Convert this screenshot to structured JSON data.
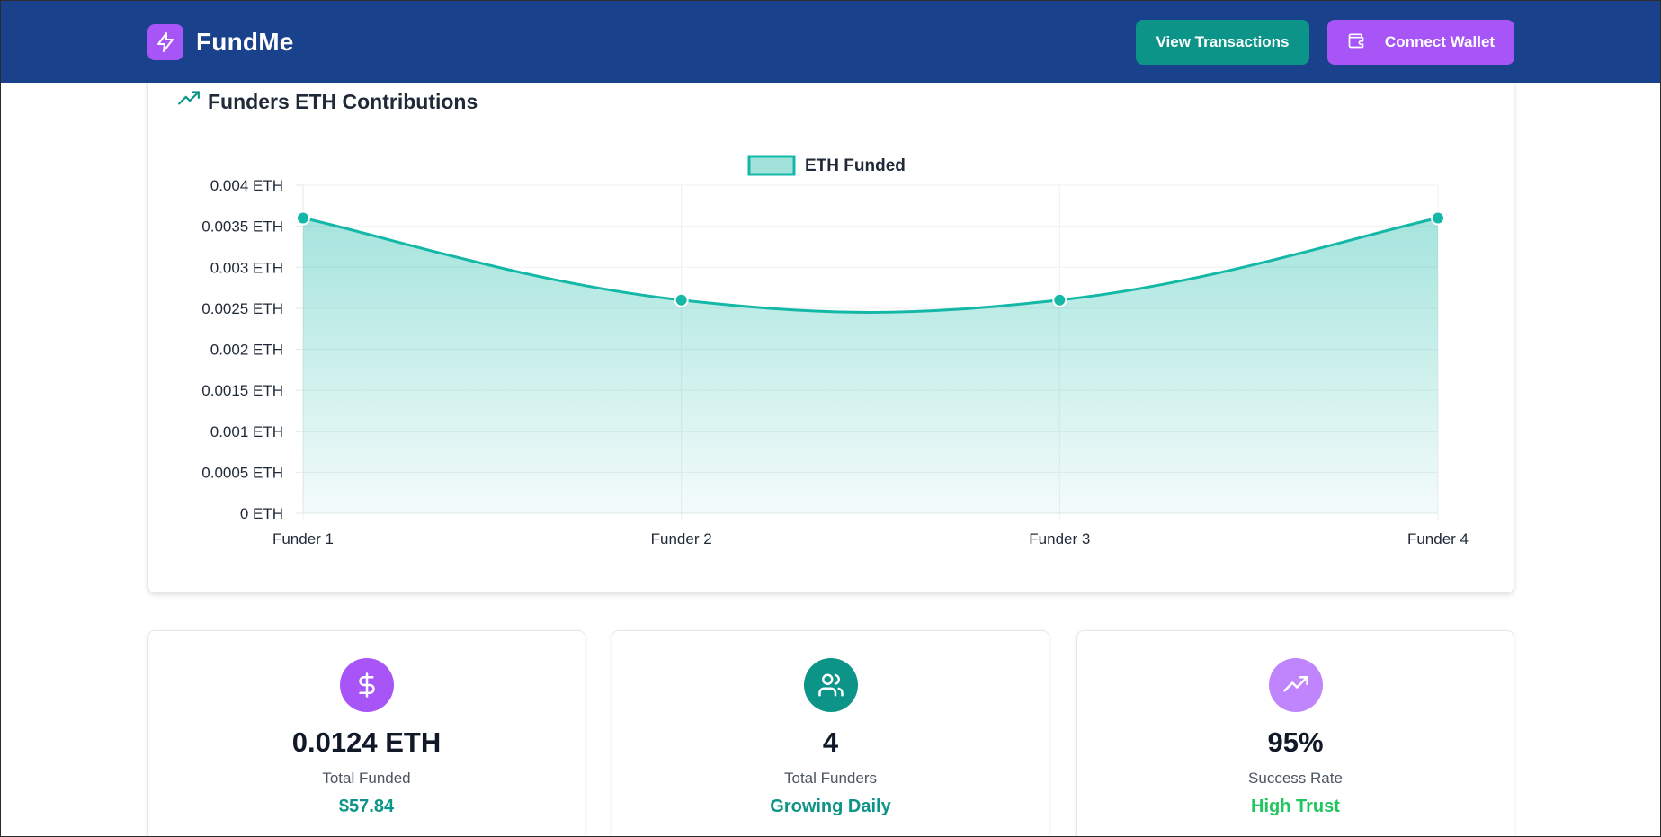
{
  "header": {
    "app_name": "FundMe",
    "logo_icon": "lightning-icon",
    "view_transactions_label": "View Transactions",
    "connect_wallet_label": "Connect Wallet",
    "wallet_icon": "wallet-icon",
    "colors": {
      "header_bg": "#1a418c",
      "brand": "#a855f7",
      "teal": "#0d9488"
    }
  },
  "chart_section": {
    "title": "Funders ETH Contributions",
    "title_icon": "trending-up-icon"
  },
  "chart_data": {
    "type": "area",
    "categories": [
      "Funder 1",
      "Funder 2",
      "Funder 3",
      "Funder 4"
    ],
    "series": [
      {
        "name": "ETH Funded",
        "values": [
          0.0036,
          0.0026,
          0.0026,
          0.0036
        ],
        "color": "#14b8a6"
      }
    ],
    "yticks": [
      "0 ETH",
      "0.0005 ETH",
      "0.001 ETH",
      "0.0015 ETH",
      "0.002 ETH",
      "0.0025 ETH",
      "0.003 ETH",
      "0.0035 ETH",
      "0.004 ETH"
    ],
    "ylim": [
      0,
      0.004
    ],
    "legend_position": "top-center",
    "grid": true,
    "smooth": true
  },
  "stats": [
    {
      "icon": "dollar-icon",
      "icon_bg": "#a855f7",
      "value": "0.0124 ETH",
      "label": "Total Funded",
      "sub": "$57.84",
      "sub_color": "#0d9488"
    },
    {
      "icon": "users-icon",
      "icon_bg": "#0d9488",
      "value": "4",
      "label": "Total Funders",
      "sub": "Growing Daily",
      "sub_color": "#0d9488"
    },
    {
      "icon": "trending-up-icon",
      "icon_bg": "#c084fc",
      "value": "95%",
      "label": "Success Rate",
      "sub": "High Trust",
      "sub_color": "#22c55e"
    }
  ]
}
